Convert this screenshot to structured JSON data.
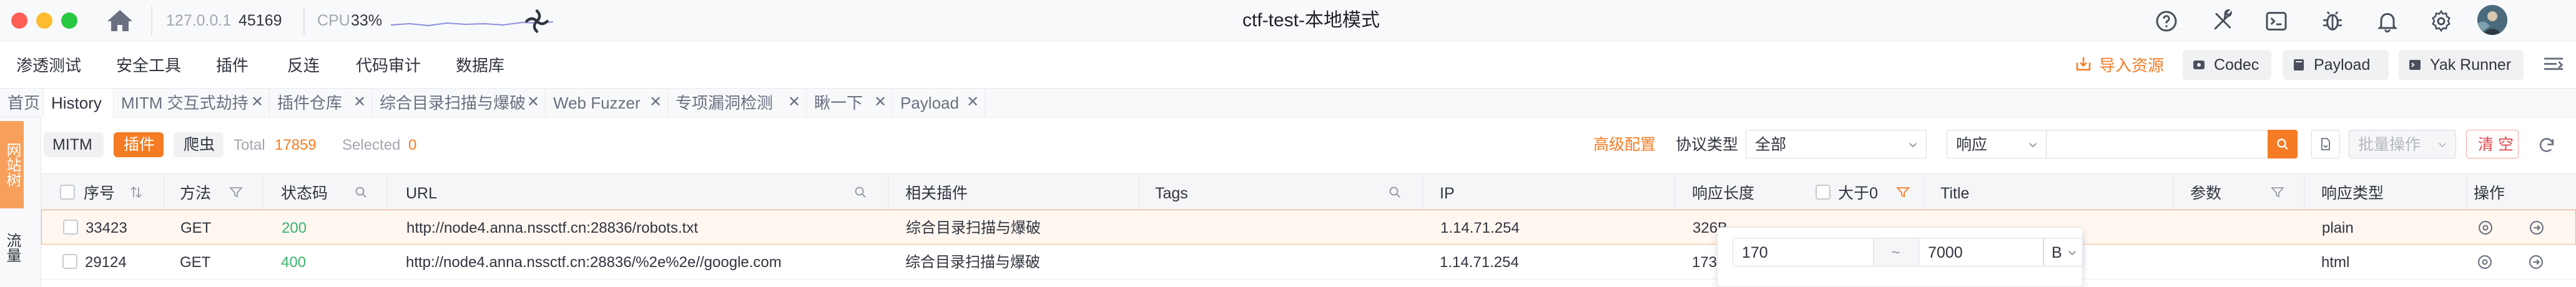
{
  "titlebar": {
    "host": "127.0.0.1",
    "port": "45169",
    "cpu_label": "CPU",
    "cpu_value": "33%",
    "window_title": "ctf-test-本地模式"
  },
  "menu": {
    "items": [
      "渗透测试",
      "安全工具",
      "插件",
      "反连",
      "代码审计",
      "数据库"
    ],
    "import_label": "导入资源",
    "codec_label": "Codec",
    "payload_label": "Payload",
    "yak_runner_label": "Yak Runner"
  },
  "tabs": [
    {
      "label": "首页",
      "closable": false
    },
    {
      "label": "History",
      "closable": false,
      "active": true
    },
    {
      "label": "MITM 交互式劫持",
      "closable": true
    },
    {
      "label": "插件仓库",
      "closable": true
    },
    {
      "label": "综合目录扫描与爆破",
      "closable": true
    },
    {
      "label": "Web Fuzzer",
      "closable": true
    },
    {
      "label": "专项漏洞检测",
      "closable": true
    },
    {
      "label": "瞅一下",
      "closable": true
    },
    {
      "label": "Payload",
      "closable": true
    }
  ],
  "leftrail": {
    "tab_active": "网站树",
    "tab_other": "流量"
  },
  "filter": {
    "chips": [
      "MITM",
      "插件",
      "爬虫"
    ],
    "total_label": "Total",
    "total_value": "17859",
    "selected_label": "Selected",
    "selected_value": "0",
    "advanced_config": "高级配置",
    "protocol_label": "协议类型",
    "protocol_value": "全部",
    "search_scope": "响应",
    "batch_label": "批量操作",
    "clear_label": "清 空"
  },
  "table": {
    "headers": {
      "seq": "序号",
      "method": "方法",
      "status": "状态码",
      "url": "URL",
      "plugin": "相关插件",
      "tags": "Tags",
      "ip": "IP",
      "resp_len": "响应长度",
      "gt0": "大于0",
      "title": "Title",
      "params": "参数",
      "resp_type": "响应类型",
      "actions": "操作"
    },
    "rows": [
      {
        "seq": "33423",
        "method": "GET",
        "status": "200",
        "url": "http://node4.anna.nssctf.cn:28836/robots.txt",
        "plugin": "综合目录扫描与爆破",
        "tags": "",
        "ip": "1.14.71.254",
        "resp_len": "326B",
        "title": "",
        "params": "",
        "resp_type": "plain"
      },
      {
        "seq": "29124",
        "method": "GET",
        "status": "400",
        "url": "http://node4.anna.nssctf.cn:28836/%2e%2e//google.com",
        "plugin": "综合目录扫描与爆破",
        "tags": "",
        "ip": "1.14.71.254",
        "resp_len": "173",
        "title": "",
        "params": "",
        "resp_type": "html"
      }
    ]
  },
  "size_filter": {
    "min": "170",
    "separator": "~",
    "max": "7000",
    "unit": "B"
  },
  "colors": {
    "accent": "#f57c24",
    "status_ok": "#3cb371",
    "link_orange": "#f28b30",
    "row_highlight": "#fff7f0"
  }
}
